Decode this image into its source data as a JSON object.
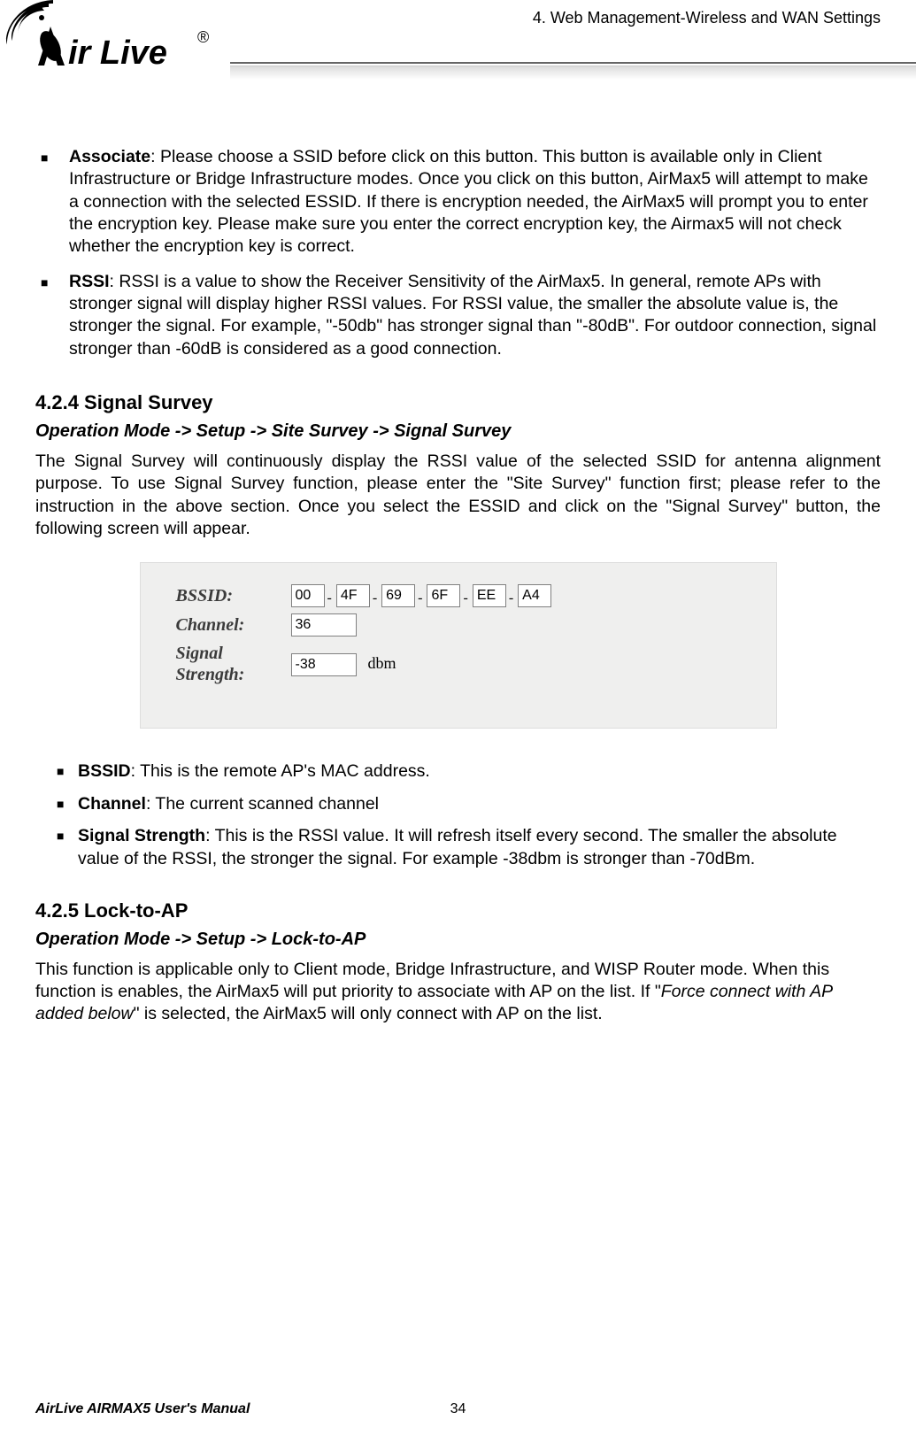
{
  "header": {
    "chapter_line": "4. Web Management-Wireless and WAN Settings"
  },
  "bullets_a": [
    {
      "label": "Associate",
      "text": ":    Please choose a SSID before click on this button.    This button is available only in Client Infrastructure or Bridge Infrastructure modes.    Once you click on this button, AirMax5 will attempt to make a connection with the selected ESSID.    If there is encryption needed, the AirMax5 will prompt you to enter the encryption key.    Please make sure you enter the correct encryption key, the Airmax5 will not check whether the encryption key is correct."
    },
    {
      "label": "RSSI",
      "text": ":    RSSI is a value to show the Receiver Sensitivity of the AirMax5.    In general, remote APs with stronger signal will display higher RSSI values.    For RSSI value, the smaller the absolute value is, the stronger the signal.    For example, \"-50db\" has stronger signal than \"-80dB\".      For outdoor connection, signal stronger than -60dB is considered as a good connection."
    }
  ],
  "section_424": {
    "title": "4.2.4 Signal Survey",
    "breadcrumb": "Operation Mode -> Setup -> Site Survey -> Signal Survey",
    "para": "The Signal Survey will continuously display the RSSI value of the selected SSID for antenna alignment purpose.  To use Signal Survey function, please enter the \"Site Survey\" function first; please refer to the instruction in the above section.    Once you select the ESSID and click on the \"Signal Survey\" button, the following screen will appear."
  },
  "panel": {
    "bssid_label": "BSSID:",
    "mac": [
      "00",
      "4F",
      "69",
      "6F",
      "EE",
      "A4"
    ],
    "channel_label": "Channel:",
    "channel": "36",
    "signal_label_line1": "Signal",
    "signal_label_line2": "Strength:",
    "signal": "-38",
    "dbm": "dbm"
  },
  "bullets_b": [
    {
      "label": "BSSID",
      "text": ": This is the remote AP's MAC address."
    },
    {
      "label": "Channel",
      "text": ":    The current scanned channel"
    },
    {
      "label": "Signal Strength",
      "text": ": This is the RSSI value.    It will refresh itself every second.    The smaller the absolute value of the RSSI, the stronger the signal.    For example -38dbm is stronger than -70dBm."
    }
  ],
  "section_425": {
    "title": "4.2.5 Lock-to-AP",
    "breadcrumb": "Operation Mode -> Setup -> Lock-to-AP",
    "para_before_italic": "This function is applicable only to Client mode, Bridge Infrastructure, and WISP Router mode.    When this function is enables, the AirMax5 will put priority to associate with AP on the list.    If \"",
    "italic_text": "Force connect with AP added below",
    "para_after_italic": "\" is selected, the AirMax5 will only connect with AP on the list."
  },
  "footer": {
    "manual": "AirLive AIRMAX5 User's Manual",
    "page": "34"
  }
}
